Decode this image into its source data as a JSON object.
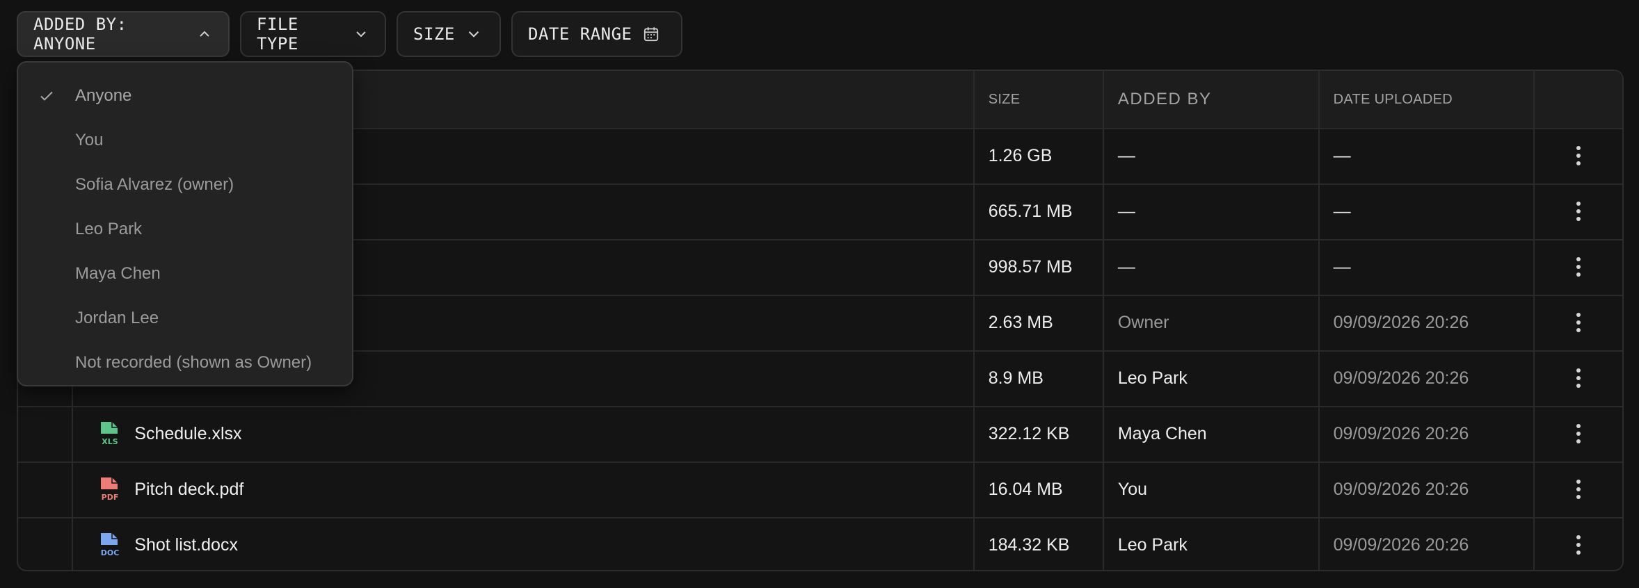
{
  "filters": {
    "added_by": "ADDED BY: ANYONE",
    "file_type": "FILE TYPE",
    "size": "SIZE",
    "date_range": "DATE RANGE"
  },
  "dropdown": {
    "options": [
      "Anyone",
      "You",
      "Sofia Alvarez (owner)",
      "Leo Park",
      "Maya Chen",
      "Jordan Lee",
      "Not recorded (shown as Owner)"
    ],
    "selected": "Anyone"
  },
  "table": {
    "headers": {
      "size": "SIZE",
      "added_by": "ADDED BY",
      "date_uploaded": "DATE UPLOADED"
    },
    "rows": [
      {
        "name": "",
        "icon": "",
        "size": "1.26 GB",
        "added_by": "—",
        "date": "—"
      },
      {
        "name": "",
        "icon": "",
        "size": "665.71 MB",
        "added_by": "—",
        "date": "—"
      },
      {
        "name": "",
        "icon": "",
        "size": "998.57 MB",
        "added_by": "—",
        "date": "—"
      },
      {
        "name": "",
        "icon": "",
        "size": "2.63 MB",
        "added_by": "Owner",
        "date": "09/09/2026 20:26"
      },
      {
        "name": "",
        "icon": "",
        "size": "8.9 MB",
        "added_by": "Leo Park",
        "date": "09/09/2026 20:26"
      },
      {
        "name": "Schedule.xlsx",
        "icon": "xls-file-icon",
        "icon_label": "XLS",
        "size": "322.12 KB",
        "added_by": "Maya Chen",
        "date": "09/09/2026 20:26"
      },
      {
        "name": "Pitch deck.pdf",
        "icon": "pdf-file-icon",
        "icon_label": "PDF",
        "size": "16.04 MB",
        "added_by": "You",
        "date": "09/09/2026 20:26"
      },
      {
        "name": "Shot list.docx",
        "icon": "doc-file-icon",
        "icon_label": "DOC",
        "size": "184.32 KB",
        "added_by": "Leo Park",
        "date": "09/09/2026 20:26"
      }
    ]
  },
  "colors": {
    "xls": "#5fc48a",
    "pdf": "#ee7d7a",
    "doc": "#7aa7f0",
    "background": "#121212"
  }
}
